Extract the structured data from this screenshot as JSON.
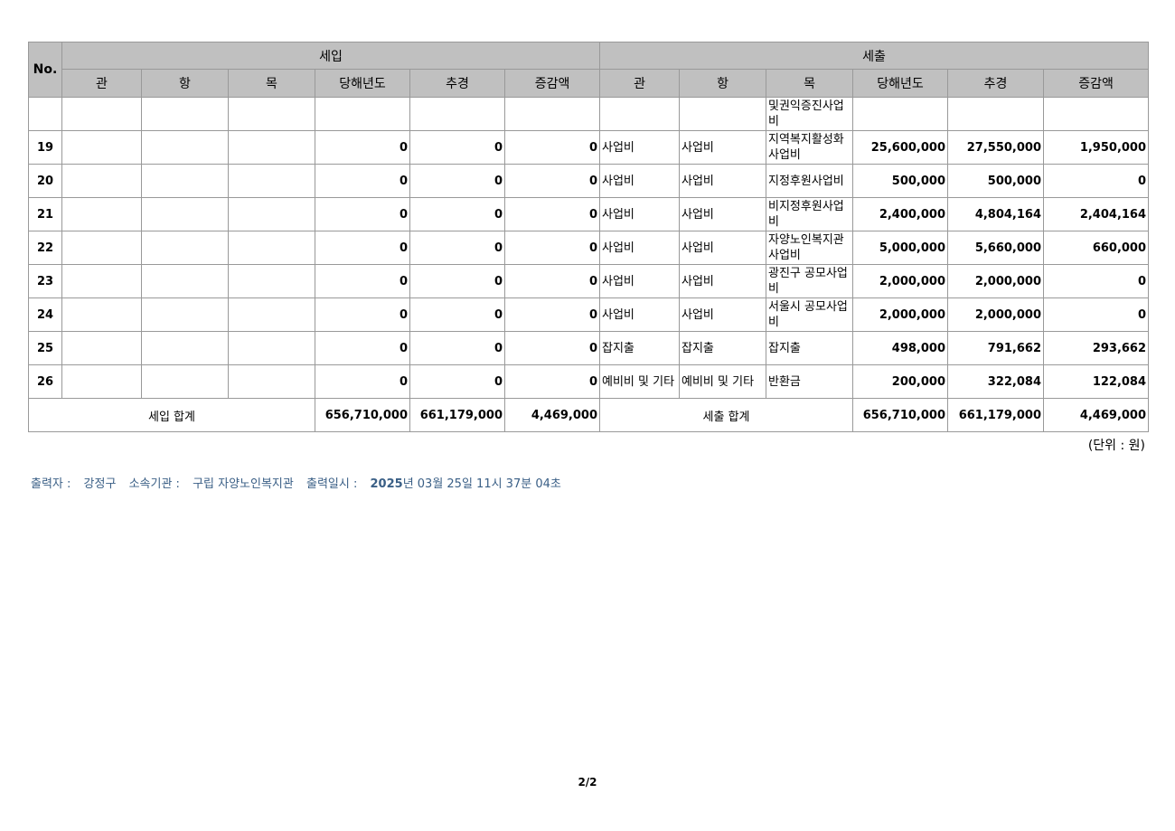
{
  "header": {
    "no": "No.",
    "income_group": "세입",
    "expense_group": "세출",
    "income_cols": [
      "관",
      "항",
      "목",
      "당해년도",
      "추경",
      "증감액"
    ],
    "expense_cols": [
      "관",
      "항",
      "목",
      "당해년도",
      "추경",
      "증감액"
    ]
  },
  "rows": [
    {
      "no": "",
      "in_gwan": "",
      "in_hang": "",
      "in_mok": "",
      "in_cur": "",
      "in_sup": "",
      "in_diff": "",
      "ex_gwan": "",
      "ex_hang": "",
      "ex_mok": "및권익증진사업비",
      "ex_cur": "",
      "ex_sup": "",
      "ex_diff": ""
    },
    {
      "no": "19",
      "in_gwan": "",
      "in_hang": "",
      "in_mok": "",
      "in_cur": "0",
      "in_sup": "0",
      "in_diff": "0",
      "ex_gwan": "사업비",
      "ex_hang": "사업비",
      "ex_mok": "지역복지활성화사업비",
      "ex_cur": "25,600,000",
      "ex_sup": "27,550,000",
      "ex_diff": "1,950,000"
    },
    {
      "no": "20",
      "in_gwan": "",
      "in_hang": "",
      "in_mok": "",
      "in_cur": "0",
      "in_sup": "0",
      "in_diff": "0",
      "ex_gwan": "사업비",
      "ex_hang": "사업비",
      "ex_mok": "지정후원사업비",
      "ex_cur": "500,000",
      "ex_sup": "500,000",
      "ex_diff": "0"
    },
    {
      "no": "21",
      "in_gwan": "",
      "in_hang": "",
      "in_mok": "",
      "in_cur": "0",
      "in_sup": "0",
      "in_diff": "0",
      "ex_gwan": "사업비",
      "ex_hang": "사업비",
      "ex_mok": "비지정후원사업비",
      "ex_cur": "2,400,000",
      "ex_sup": "4,804,164",
      "ex_diff": "2,404,164"
    },
    {
      "no": "22",
      "in_gwan": "",
      "in_hang": "",
      "in_mok": "",
      "in_cur": "0",
      "in_sup": "0",
      "in_diff": "0",
      "ex_gwan": "사업비",
      "ex_hang": "사업비",
      "ex_mok": "자양노인복지관사업비",
      "ex_cur": "5,000,000",
      "ex_sup": "5,660,000",
      "ex_diff": "660,000"
    },
    {
      "no": "23",
      "in_gwan": "",
      "in_hang": "",
      "in_mok": "",
      "in_cur": "0",
      "in_sup": "0",
      "in_diff": "0",
      "ex_gwan": "사업비",
      "ex_hang": "사업비",
      "ex_mok": "광진구 공모사업비",
      "ex_cur": "2,000,000",
      "ex_sup": "2,000,000",
      "ex_diff": "0"
    },
    {
      "no": "24",
      "in_gwan": "",
      "in_hang": "",
      "in_mok": "",
      "in_cur": "0",
      "in_sup": "0",
      "in_diff": "0",
      "ex_gwan": "사업비",
      "ex_hang": "사업비",
      "ex_mok": "서울시 공모사업비",
      "ex_cur": "2,000,000",
      "ex_sup": "2,000,000",
      "ex_diff": "0"
    },
    {
      "no": "25",
      "in_gwan": "",
      "in_hang": "",
      "in_mok": "",
      "in_cur": "0",
      "in_sup": "0",
      "in_diff": "0",
      "ex_gwan": "잡지출",
      "ex_hang": "잡지출",
      "ex_mok": "잡지출",
      "ex_cur": "498,000",
      "ex_sup": "791,662",
      "ex_diff": "293,662",
      "short": true
    },
    {
      "no": "26",
      "in_gwan": "",
      "in_hang": "",
      "in_mok": "",
      "in_cur": "0",
      "in_sup": "0",
      "in_diff": "0",
      "ex_gwan": "예비비 및 기타",
      "ex_hang": "예비비 및 기타",
      "ex_mok": "반환금",
      "ex_cur": "200,000",
      "ex_sup": "322,084",
      "ex_diff": "122,084"
    }
  ],
  "totals": {
    "income_label": "세입 합계",
    "in_cur": "656,710,000",
    "in_sup": "661,179,000",
    "in_diff": "4,469,000",
    "expense_label": "세출 합계",
    "ex_cur": "656,710,000",
    "ex_sup": "661,179,000",
    "ex_diff": "4,469,000"
  },
  "unit": "(단위 : 원)",
  "footer": {
    "printer_label": "출력자 :",
    "printer": "강정구",
    "org_label": "소속기관 :",
    "org": "구립 자양노인복지관",
    "time_label": "출력일시 :",
    "time_year": "2025",
    "time_rest": "년 03월 25일 11시 37분 04초"
  },
  "page_number": "2/2"
}
